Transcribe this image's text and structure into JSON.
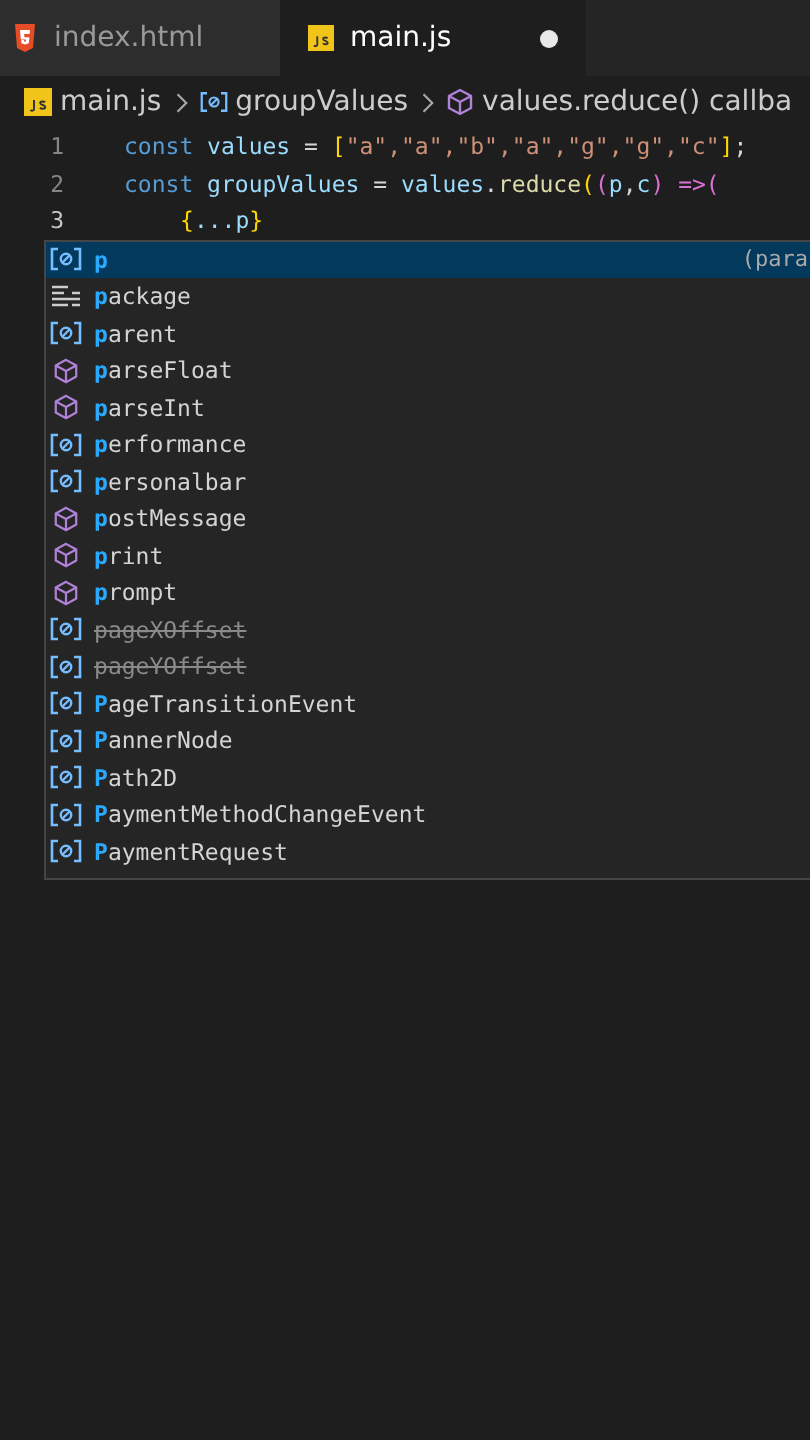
{
  "tabs": [
    {
      "label": "index.html",
      "kind": "html",
      "selected": false,
      "dirty": false
    },
    {
      "label": "main.js",
      "kind": "js",
      "selected": true,
      "dirty": true
    }
  ],
  "breadcrumb": [
    {
      "label": "main.js",
      "kind": "js"
    },
    {
      "label": "groupValues",
      "kind": "variable"
    },
    {
      "label": "values.reduce() callba",
      "kind": "method"
    }
  ],
  "code_lines": [
    {
      "number": "1",
      "tokens": [
        {
          "t": "const ",
          "kind": "keyword"
        },
        {
          "t": "values",
          "kind": "variable"
        },
        {
          "t": " = ",
          "kind": "plain"
        },
        {
          "t": "[",
          "kind": "bracket"
        },
        {
          "t": "\"a\",\"a\",\"b\",\"a\",\"g\",\"g\",\"c\"",
          "kind": "string"
        },
        {
          "t": "]",
          "kind": "bracket"
        },
        {
          "t": ";",
          "kind": "plain"
        }
      ]
    },
    {
      "number": "2",
      "tokens": [
        {
          "t": "const ",
          "kind": "keyword"
        },
        {
          "t": "groupValues",
          "kind": "variable"
        },
        {
          "t": " = ",
          "kind": "plain"
        },
        {
          "t": "values",
          "kind": "variable"
        },
        {
          "t": ".",
          "kind": "plain"
        },
        {
          "t": "reduce",
          "kind": "function"
        },
        {
          "t": "(",
          "kind": "bracket"
        },
        {
          "t": "(",
          "kind": "bracket2"
        },
        {
          "t": "p",
          "kind": "variable"
        },
        {
          "t": ",",
          "kind": "plain"
        },
        {
          "t": "c",
          "kind": "variable"
        },
        {
          "t": ") =>(",
          "kind": "bracket2"
        }
      ]
    },
    {
      "number": "3",
      "tokens": [
        {
          "t": "{",
          "kind": "bracket"
        },
        {
          "t": "...p",
          "kind": "variable"
        },
        {
          "t": "}",
          "kind": "bracket"
        }
      ]
    }
  ],
  "suggestions": [
    {
      "match": "p",
      "kind": "variable",
      "deprecated": false,
      "selected": true,
      "detail": "(para"
    },
    {
      "match": "p",
      "rest": "ackage",
      "kind": "keyword",
      "deprecated": false,
      "selected": false
    },
    {
      "match": "p",
      "rest": "arent",
      "kind": "variable",
      "deprecated": false,
      "selected": false
    },
    {
      "match": "p",
      "rest": "arseFloat",
      "kind": "method",
      "deprecated": false,
      "selected": false
    },
    {
      "match": "p",
      "rest": "arseInt",
      "kind": "method",
      "deprecated": false,
      "selected": false
    },
    {
      "match": "p",
      "rest": "erformance",
      "kind": "variable",
      "deprecated": false,
      "selected": false
    },
    {
      "match": "p",
      "rest": "ersonalbar",
      "kind": "variable",
      "deprecated": false,
      "selected": false
    },
    {
      "match": "p",
      "rest": "ostMessage",
      "kind": "method",
      "deprecated": false,
      "selected": false
    },
    {
      "match": "p",
      "rest": "rint",
      "kind": "method",
      "deprecated": false,
      "selected": false
    },
    {
      "match": "p",
      "rest": "rompt",
      "kind": "method",
      "deprecated": false,
      "selected": false
    },
    {
      "match": "p",
      "rest": "ageXOffset",
      "kind": "variable",
      "deprecated": true,
      "selected": false
    },
    {
      "match": "p",
      "rest": "ageYOffset",
      "kind": "variable",
      "deprecated": true,
      "selected": false
    },
    {
      "match": "P",
      "rest": "ageTransitionEvent",
      "kind": "variable",
      "deprecated": false,
      "selected": false
    },
    {
      "match": "P",
      "rest": "annerNode",
      "kind": "variable",
      "deprecated": false,
      "selected": false
    },
    {
      "match": "P",
      "rest": "ath2D",
      "kind": "variable",
      "deprecated": false,
      "selected": false
    },
    {
      "match": "P",
      "rest": "aymentMethodChangeEvent",
      "kind": "variable",
      "deprecated": false,
      "selected": false
    },
    {
      "match": "P",
      "rest": "aymentRequest",
      "kind": "variable",
      "deprecated": false,
      "selected": false
    }
  ]
}
